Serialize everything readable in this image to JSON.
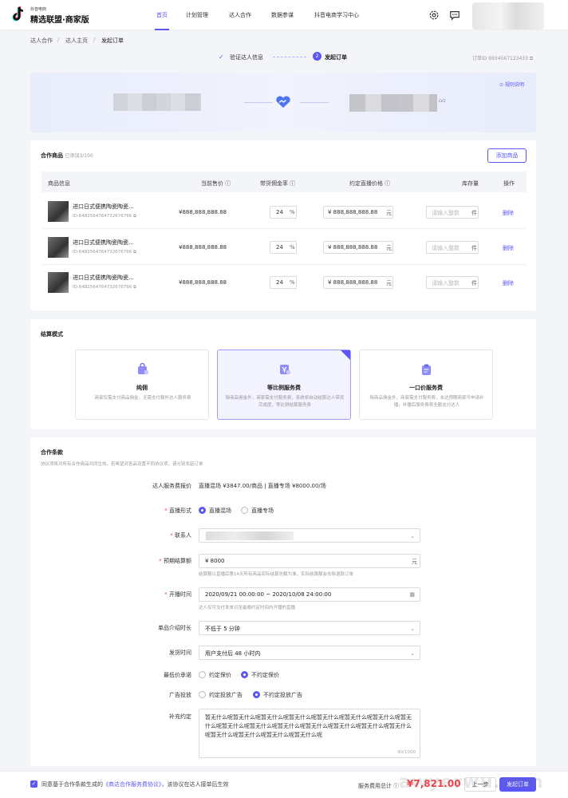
{
  "header": {
    "logo_small": "抖音电商",
    "logo_big": "精选联盟·商家版",
    "nav": [
      "首页",
      "计划管理",
      "达人合作",
      "数据参谋",
      "抖音电商学习中心"
    ]
  },
  "breadcrumb": [
    "达人合作",
    "达人主页",
    "发起订单"
  ],
  "steps": {
    "step1": "验证达人信息",
    "step2_num": "2",
    "step2": "发起订单",
    "order_id": "订单ID 9934567123433"
  },
  "banner": {
    "rule_link": "规则说明",
    "level": "LV2"
  },
  "products": {
    "title": "合作商品",
    "count": "已添加3/100",
    "add_button": "添加商品",
    "columns": [
      "商品信息",
      "当前售价",
      "带货佣金率",
      "约定直播价格",
      "库存量",
      "操作"
    ],
    "rows": [
      {
        "name": "进口日式便携陶瓷陶瓷...",
        "id": "ID:6482564764732676766",
        "price": "¥888,888,888.88",
        "rate": "24",
        "rate_unit": "%",
        "live_price": "¥  888,888,888.88",
        "live_unit": "元",
        "stock_placeholder": "请输入整数",
        "stock_unit": "件",
        "action": "删除"
      },
      {
        "name": "进口日式便携陶瓷陶瓷...",
        "id": "ID:6482564764732676766",
        "price": "¥888,888,888.88",
        "rate": "24",
        "rate_unit": "%",
        "live_price": "¥  888,888,888.88",
        "live_unit": "元",
        "stock_placeholder": "请输入整数",
        "stock_unit": "件",
        "action": "删除"
      },
      {
        "name": "进口日式便携陶瓷陶瓷...",
        "id": "ID:6482564764732676766",
        "price": "¥888,888,888.88",
        "rate": "24",
        "rate_unit": "%",
        "live_price": "¥  888,888,888.88",
        "live_unit": "元",
        "stock_placeholder": "请输入整数",
        "stock_unit": "件",
        "action": "删除"
      }
    ]
  },
  "settlement": {
    "title": "结算模式",
    "options": [
      {
        "title": "纯佣",
        "desc": "商家仅需支付商品佣金，无需支付额外达人服务费"
      },
      {
        "title": "等比例服务费",
        "desc": "除商品佣金外，商家需支付服务费，系统将自动结算达人带货完成度，等比例结算服务费"
      },
      {
        "title": "一口价服务费",
        "desc": "除商品佣金外，商家需支付服务费，未达预期商家可申请补播，补播后服务费将全额支付达人"
      }
    ]
  },
  "terms": {
    "title": "合作条款",
    "subtitle": "协议须将对所有合作商品共同生效，若希望对各品设置不同协议项，请分别发起订单",
    "quote_label": "达人服务费报价",
    "quote_value": "直播混场 ¥3847.00/商品  |  直播专场 ¥8000.00/场",
    "live_form_label": "直播形式",
    "live_form_options": [
      "直播混场",
      "直播专场"
    ],
    "contact_label": "联系人",
    "budget_label": "预期结算额",
    "budget_value": "¥   8000",
    "budget_unit": "元",
    "budget_hint": "结算额以直播后第14天所有商品实际结算总额为准，实际结算额会去除退款订单",
    "time_label": "开播时间",
    "time_value": "2020/09/21 00:00:00  ~  2020/10/08 24:00:00",
    "time_hint": "达人仅可交付发单日至最晚约定时间内开播的直播",
    "duration_label": "单品介绍时长",
    "duration_value": "不低于 5 分钟",
    "ship_label": "发货时间",
    "ship_value": "用户支付后 48 小时内",
    "lowest_label": "最低价承诺",
    "lowest_options": [
      "约定保价",
      "不约定保价"
    ],
    "ad_label": "广告投放",
    "ad_options": [
      "约定投放广告",
      "不约定投放广告"
    ],
    "extra_label": "补充约定",
    "extra_text": "暂无什么呢暂无什么呢暂无什么呢暂无什么呢暂无什么呢暂无什么呢暂无什么呢暂无什么呢暂无什么呢暂无什么呢暂无什么呢暂无什么呢暂无什么呢暂无什么呢暂无什么呢暂无什么呢暂无什么呢暂无什么呢暂无什么呢",
    "extra_count": "90/1000"
  },
  "footer": {
    "agree_prefix": "同意基于合作条款生成的",
    "agree_link": "《商达合作服务费协议》",
    "agree_suffix": "，该协议在达人接单后生效",
    "fee_label": "服务费用总计",
    "fee_value": "¥7,821.00",
    "prev_button": "上一步",
    "submit_button": "发起订单",
    "watermark": "awyerwu.com"
  },
  "colors": {
    "accent": "#5a57f5",
    "price_red": "#f2414c"
  }
}
